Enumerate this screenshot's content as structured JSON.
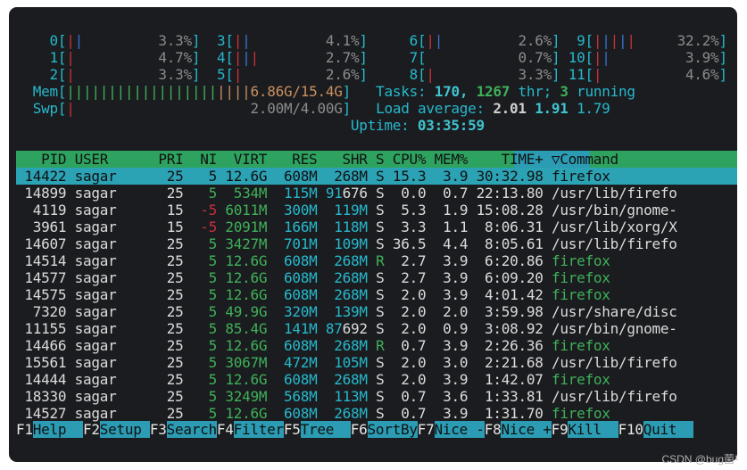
{
  "cpu_meters": [
    {
      "id": "0",
      "bars": "||",
      "pct": "3.3%"
    },
    {
      "id": "1",
      "bars": "|",
      "pct": "4.7%"
    },
    {
      "id": "2",
      "bars": "|",
      "pct": "3.3%"
    },
    {
      "id": "3",
      "bars": "||",
      "pct": "4.1%"
    },
    {
      "id": "4",
      "bars": "|||",
      "pct": "2.7%"
    },
    {
      "id": "5",
      "bars": "|",
      "pct": "2.6%"
    },
    {
      "id": "6",
      "bars": "||",
      "pct": "2.6%"
    },
    {
      "id": "7",
      "bars": "",
      "pct": "0.7%"
    },
    {
      "id": "8",
      "bars": "|",
      "pct": "3.3%"
    },
    {
      "id": "9",
      "bars": "|||||",
      "pct": "32.2%"
    },
    {
      "id": "10",
      "bars": "||",
      "pct": "3.9%"
    },
    {
      "id": "11",
      "bars": "|",
      "pct": "4.6%"
    }
  ],
  "mem": {
    "label": "Mem",
    "bars": "||||||||||||||||||||||",
    "value": "6.86G/15.4G"
  },
  "swp": {
    "label": "Swp",
    "bars": "|",
    "value": "2.00M/4.00G"
  },
  "tasks": {
    "label": "Tasks:",
    "count": "170,",
    "threads": "1267",
    "thr": "thr;",
    "running": "3",
    "running_label": "running"
  },
  "load": {
    "label": "Load average:",
    "v1": "2.01",
    "v2": "1.91",
    "v3": "1.79"
  },
  "uptime": {
    "label": "Uptime:",
    "value": "03:35:59"
  },
  "columns": {
    "pid": "PID",
    "user": "USER",
    "pri": "PRI",
    "ni": "NI",
    "virt": "VIRT",
    "res": "RES",
    "shr": "SHR",
    "s": "S",
    "cpu": "CPU%",
    "mem": "MEM%",
    "time": "TIME+",
    "cmd": "▽Command"
  },
  "processes": [
    {
      "pid": "14422",
      "user": "sagar",
      "pri": "25",
      "ni": "5",
      "virt": "12.6G",
      "res": "608M",
      "shr": "268M",
      "s": "S",
      "cpu": "15.3",
      "mem": "3.9",
      "time": "30:32.98",
      "cmd": "firefox"
    },
    {
      "pid": "14899",
      "user": "sagar",
      "pri": "25",
      "ni": "5",
      "virt": "534M",
      "res": "115M",
      "shr": "91676",
      "s": "S",
      "cpu": "0.0",
      "mem": "0.7",
      "time": "22:13.80",
      "cmd": "/usr/lib/firefo"
    },
    {
      "pid": "4119",
      "user": "sagar",
      "pri": "15",
      "ni": "-5",
      "virt": "6011M",
      "res": "300M",
      "shr": "119M",
      "s": "S",
      "cpu": "5.3",
      "mem": "1.9",
      "time": "15:08.28",
      "cmd": "/usr/bin/gnome-"
    },
    {
      "pid": "3961",
      "user": "sagar",
      "pri": "15",
      "ni": "-5",
      "virt": "2091M",
      "res": "166M",
      "shr": "118M",
      "s": "S",
      "cpu": "3.3",
      "mem": "1.1",
      "time": "8:06.31",
      "cmd": "/usr/lib/xorg/X"
    },
    {
      "pid": "14607",
      "user": "sagar",
      "pri": "25",
      "ni": "5",
      "virt": "3427M",
      "res": "701M",
      "shr": "109M",
      "s": "S",
      "cpu": "36.5",
      "mem": "4.4",
      "time": "8:05.61",
      "cmd": "/usr/lib/firefo"
    },
    {
      "pid": "14514",
      "user": "sagar",
      "pri": "25",
      "ni": "5",
      "virt": "12.6G",
      "res": "608M",
      "shr": "268M",
      "s": "R",
      "cpu": "2.7",
      "mem": "3.9",
      "time": "6:20.86",
      "cmd": "firefox"
    },
    {
      "pid": "14577",
      "user": "sagar",
      "pri": "25",
      "ni": "5",
      "virt": "12.6G",
      "res": "608M",
      "shr": "268M",
      "s": "S",
      "cpu": "2.7",
      "mem": "3.9",
      "time": "6:09.20",
      "cmd": "firefox"
    },
    {
      "pid": "14575",
      "user": "sagar",
      "pri": "25",
      "ni": "5",
      "virt": "12.6G",
      "res": "608M",
      "shr": "268M",
      "s": "S",
      "cpu": "2.0",
      "mem": "3.9",
      "time": "4:01.42",
      "cmd": "firefox"
    },
    {
      "pid": "7320",
      "user": "sagar",
      "pri": "25",
      "ni": "5",
      "virt": "49.9G",
      "res": "320M",
      "shr": "139M",
      "s": "S",
      "cpu": "2.0",
      "mem": "2.0",
      "time": "3:59.98",
      "cmd": "/usr/share/disc"
    },
    {
      "pid": "11155",
      "user": "sagar",
      "pri": "25",
      "ni": "5",
      "virt": "85.4G",
      "res": "141M",
      "shr": "87692",
      "s": "S",
      "cpu": "2.0",
      "mem": "0.9",
      "time": "3:08.92",
      "cmd": "/usr/bin/gnome-"
    },
    {
      "pid": "14466",
      "user": "sagar",
      "pri": "25",
      "ni": "5",
      "virt": "12.6G",
      "res": "608M",
      "shr": "268M",
      "s": "R",
      "cpu": "0.7",
      "mem": "3.9",
      "time": "2:26.36",
      "cmd": "firefox"
    },
    {
      "pid": "15561",
      "user": "sagar",
      "pri": "25",
      "ni": "5",
      "virt": "3067M",
      "res": "472M",
      "shr": "105M",
      "s": "S",
      "cpu": "2.0",
      "mem": "3.0",
      "time": "2:21.68",
      "cmd": "/usr/lib/firefo"
    },
    {
      "pid": "14444",
      "user": "sagar",
      "pri": "25",
      "ni": "5",
      "virt": "12.6G",
      "res": "608M",
      "shr": "268M",
      "s": "S",
      "cpu": "2.0",
      "mem": "3.9",
      "time": "1:42.07",
      "cmd": "firefox"
    },
    {
      "pid": "18330",
      "user": "sagar",
      "pri": "25",
      "ni": "5",
      "virt": "3249M",
      "res": "568M",
      "shr": "113M",
      "s": "S",
      "cpu": "0.7",
      "mem": "3.6",
      "time": "1:33.81",
      "cmd": "/usr/lib/firefo"
    },
    {
      "pid": "14527",
      "user": "sagar",
      "pri": "25",
      "ni": "5",
      "virt": "12.6G",
      "res": "608M",
      "shr": "268M",
      "s": "S",
      "cpu": "0.7",
      "mem": "3.9",
      "time": "1:31.70",
      "cmd": "firefox"
    }
  ],
  "fkeys": [
    {
      "key": "F1",
      "label": "Help  "
    },
    {
      "key": "F2",
      "label": "Setup "
    },
    {
      "key": "F3",
      "label": "Search"
    },
    {
      "key": "F4",
      "label": "Filter"
    },
    {
      "key": "F5",
      "label": "Tree  "
    },
    {
      "key": "F6",
      "label": "SortBy"
    },
    {
      "key": "F7",
      "label": "Nice -"
    },
    {
      "key": "F8",
      "label": "Nice +"
    },
    {
      "key": "F9",
      "label": "Kill  "
    },
    {
      "key": "F10",
      "label": "Quit  "
    }
  ],
  "watermark": "CSDN @bug菌¹",
  "colors": {
    "terminal_bg": "#1b1c1f",
    "header_green": "#2ea35f",
    "selection_cyan": "#2ca2b5",
    "accent_cyan": "#26b8cc"
  }
}
